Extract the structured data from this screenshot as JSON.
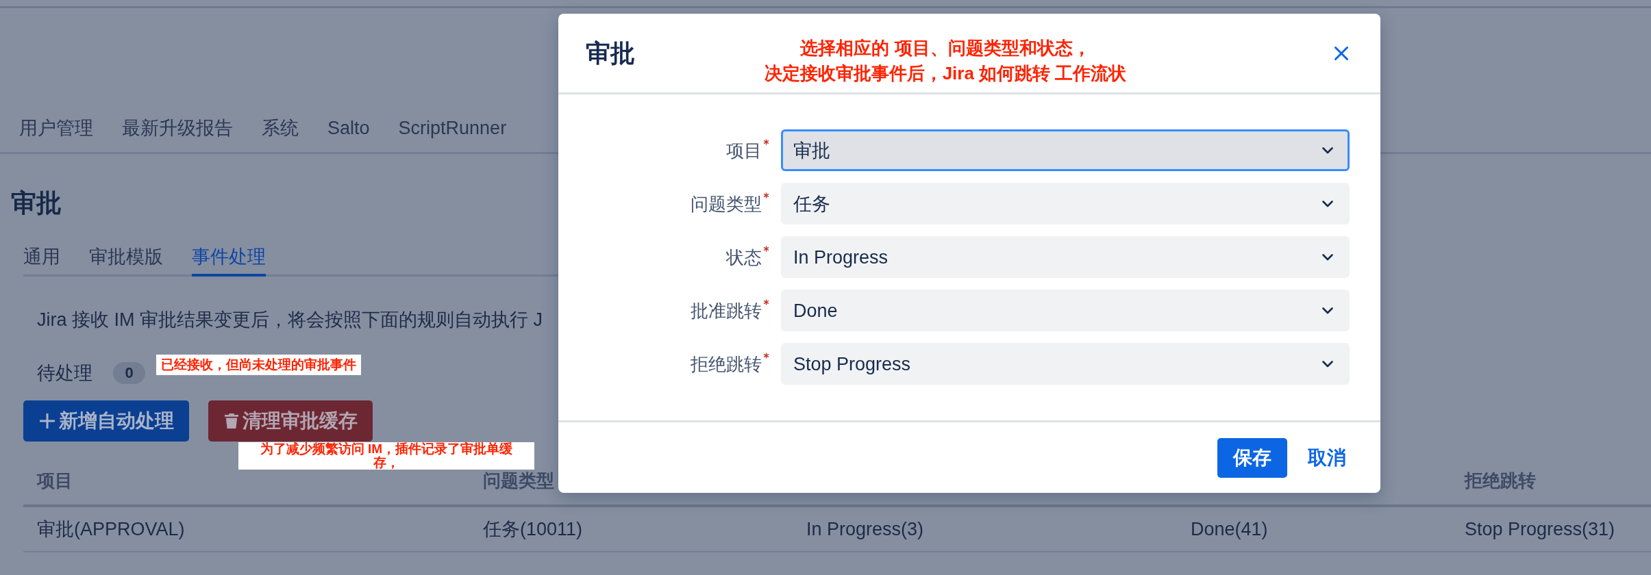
{
  "top_nav": {
    "items": [
      {
        "label": "用户管理"
      },
      {
        "label": "最新升级报告"
      },
      {
        "label": "系统"
      },
      {
        "label": "Salto"
      },
      {
        "label": "ScriptRunner"
      }
    ]
  },
  "page_title": "审批",
  "tabs": [
    {
      "label": "通用",
      "selected": false
    },
    {
      "label": "审批模版",
      "selected": false
    },
    {
      "label": "事件处理",
      "selected": true
    }
  ],
  "description": "Jira 接收 IM 审批结果变更后，将会按照下面的规则自动执行 J",
  "pending": {
    "label": "待处理",
    "count": "0",
    "note": "已经接收，但尚未处理的审批事件"
  },
  "actions": [
    {
      "kind": "primary",
      "label": "新增自动处理"
    },
    {
      "kind": "danger",
      "label": "清理审批缓存",
      "note": "为了减少频繁访问 IM，插件记录了审批单缓存，"
    }
  ],
  "table": {
    "columns": [
      {
        "label": "项目"
      },
      {
        "label": "问题类型"
      },
      {},
      {},
      {
        "label": "拒绝跳转"
      }
    ],
    "rows": [
      {
        "cells": [
          "审批(APPROVAL)",
          "任务(10011)",
          "In Progress(3)",
          "Done(41)",
          "Stop Progress(31)"
        ]
      }
    ]
  },
  "dialog": {
    "title": "审批",
    "note": [
      "选择相应的 项目、问题类型和状态，",
      "决定接收审批事件后，Jira 如何跳转 工作流状"
    ],
    "fields": [
      {
        "label": "项目",
        "required": true,
        "value": "审批",
        "focused": true
      },
      {
        "label": "问题类型",
        "required": true,
        "value": "任务",
        "focused": false
      },
      {
        "label": "状态",
        "required": true,
        "value": "In Progress",
        "focused": false
      },
      {
        "label": "批准跳转",
        "required": true,
        "value": "Done",
        "focused": false
      },
      {
        "label": "拒绝跳转",
        "required": true,
        "value": "Stop Progress",
        "focused": false
      }
    ],
    "buttons": [
      {
        "kind": "primary",
        "label": "保存"
      },
      {
        "kind": "link",
        "label": "取消"
      }
    ]
  }
}
